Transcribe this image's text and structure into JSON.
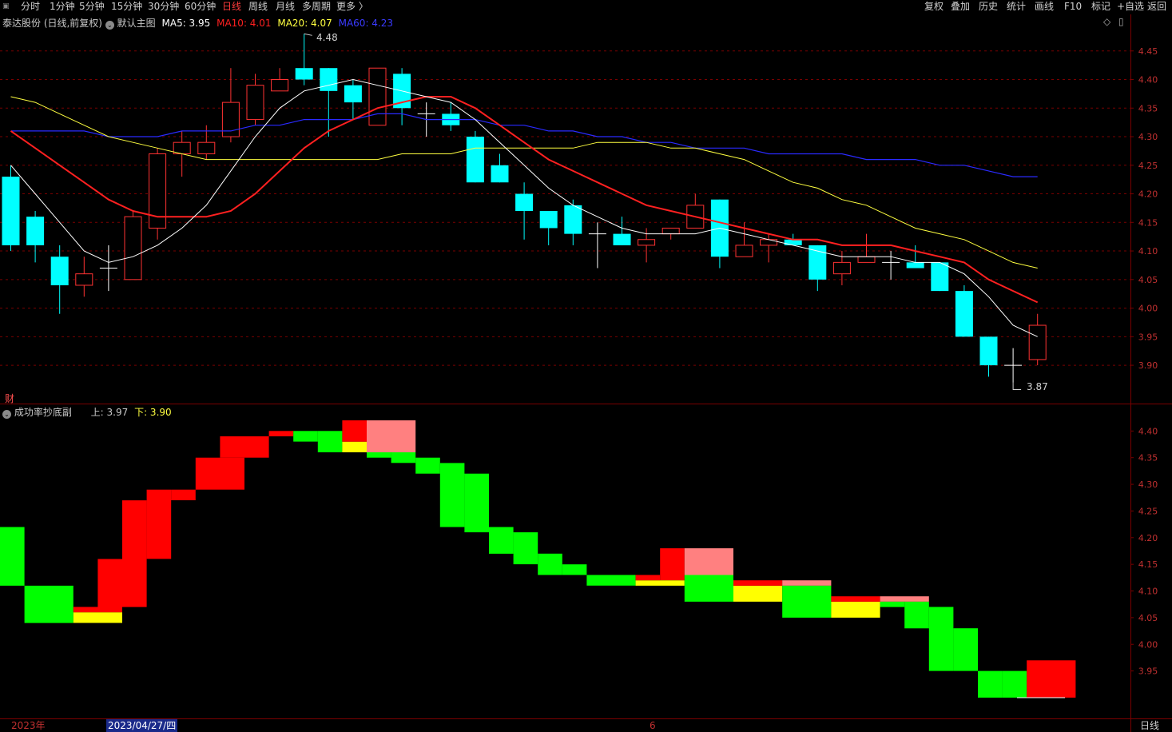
{
  "toolbar": {
    "left_items": [
      "分时",
      "1分钟",
      "5分钟",
      "15分钟",
      "30分钟",
      "60分钟",
      "日线",
      "周线",
      "月线",
      "多周期",
      "更多 〉"
    ],
    "active": "日线",
    "right_items": [
      "复权",
      "叠加",
      "历史",
      "统计",
      "画线",
      "F10",
      "标记",
      "+自选",
      "返回"
    ]
  },
  "main_legend": {
    "stock": "泰达股份 (日线,前复权)",
    "template": "默认主图",
    "ma5": "MA5: 3.95",
    "ma10": "MA10: 4.01",
    "ma20": "MA20: 4.07",
    "ma60": "MA60: 4.23"
  },
  "annotations": {
    "high": "4.48",
    "low": "3.87",
    "cai": "财"
  },
  "sub_legend": {
    "name": "成功率抄底副",
    "up": "上: 3.97",
    "down": "下: 3.90"
  },
  "bottom": {
    "year": "2023年",
    "date": "2023/04/27/四",
    "month": "6",
    "period": "日线"
  },
  "colors": {
    "bg": "#000000",
    "up": "#ff3232",
    "down": "#00ffff",
    "ma5": "#ffffff",
    "ma10": "#ff2020",
    "ma20": "#ffff40",
    "ma60": "#2a2aff",
    "grid": "#7a0000",
    "green": "#00ff00",
    "red": "#ff0000",
    "yellow": "#ffff00",
    "pink": "#ff8080"
  },
  "chart_data": [
    {
      "type": "candlestick",
      "title": "泰达股份 (日线,前复权)",
      "y_ticks": [
        "4.45",
        "4.40",
        "4.35",
        "4.30",
        "4.25",
        "4.20",
        "4.15",
        "4.10",
        "4.05",
        "4.00",
        "3.95",
        "3.90"
      ],
      "ylim": [
        3.84,
        4.5
      ],
      "candles": [
        {
          "o": 4.23,
          "c": 4.11,
          "h": 4.25,
          "l": 4.1
        },
        {
          "o": 4.16,
          "c": 4.11,
          "h": 4.17,
          "l": 4.08
        },
        {
          "o": 4.09,
          "c": 4.04,
          "h": 4.11,
          "l": 3.99
        },
        {
          "o": 4.04,
          "c": 4.06,
          "h": 4.09,
          "l": 4.02
        },
        {
          "o": 4.07,
          "c": 4.07,
          "h": 4.11,
          "l": 4.03
        },
        {
          "o": 4.05,
          "c": 4.16,
          "h": 4.17,
          "l": 4.05
        },
        {
          "o": 4.14,
          "c": 4.27,
          "h": 4.28,
          "l": 4.12
        },
        {
          "o": 4.27,
          "c": 4.29,
          "h": 4.31,
          "l": 4.23
        },
        {
          "o": 4.27,
          "c": 4.29,
          "h": 4.32,
          "l": 4.26
        },
        {
          "o": 4.3,
          "c": 4.36,
          "h": 4.42,
          "l": 4.29
        },
        {
          "o": 4.33,
          "c": 4.39,
          "h": 4.41,
          "l": 4.32
        },
        {
          "o": 4.38,
          "c": 4.4,
          "h": 4.42,
          "l": 4.38
        },
        {
          "o": 4.42,
          "c": 4.4,
          "h": 4.48,
          "l": 4.39
        },
        {
          "o": 4.42,
          "c": 4.38,
          "h": 4.42,
          "l": 4.3
        },
        {
          "o": 4.39,
          "c": 4.36,
          "h": 4.4,
          "l": 4.33
        },
        {
          "o": 4.32,
          "c": 4.42,
          "h": 4.42,
          "l": 4.32
        },
        {
          "o": 4.41,
          "c": 4.35,
          "h": 4.42,
          "l": 4.32
        },
        {
          "o": 4.34,
          "c": 4.34,
          "h": 4.36,
          "l": 4.3
        },
        {
          "o": 4.34,
          "c": 4.32,
          "h": 4.36,
          "l": 4.31
        },
        {
          "o": 4.3,
          "c": 4.22,
          "h": 4.31,
          "l": 4.22
        },
        {
          "o": 4.25,
          "c": 4.22,
          "h": 4.27,
          "l": 4.22
        },
        {
          "o": 4.2,
          "c": 4.17,
          "h": 4.22,
          "l": 4.12
        },
        {
          "o": 4.17,
          "c": 4.14,
          "h": 4.17,
          "l": 4.11
        },
        {
          "o": 4.18,
          "c": 4.13,
          "h": 4.19,
          "l": 4.11
        },
        {
          "o": 4.13,
          "c": 4.13,
          "h": 4.15,
          "l": 4.07
        },
        {
          "o": 4.13,
          "c": 4.11,
          "h": 4.16,
          "l": 4.11
        },
        {
          "o": 4.11,
          "c": 4.12,
          "h": 4.14,
          "l": 4.08
        },
        {
          "o": 4.13,
          "c": 4.14,
          "h": 4.14,
          "l": 4.12
        },
        {
          "o": 4.14,
          "c": 4.18,
          "h": 4.2,
          "l": 4.14
        },
        {
          "o": 4.19,
          "c": 4.09,
          "h": 4.19,
          "l": 4.07
        },
        {
          "o": 4.09,
          "c": 4.11,
          "h": 4.15,
          "l": 4.09
        },
        {
          "o": 4.11,
          "c": 4.12,
          "h": 4.13,
          "l": 4.08
        },
        {
          "o": 4.12,
          "c": 4.11,
          "h": 4.13,
          "l": 4.11
        },
        {
          "o": 4.11,
          "c": 4.05,
          "h": 4.11,
          "l": 4.03
        },
        {
          "o": 4.06,
          "c": 4.08,
          "h": 4.1,
          "l": 4.04
        },
        {
          "o": 4.08,
          "c": 4.09,
          "h": 4.13,
          "l": 4.08
        },
        {
          "o": 4.08,
          "c": 4.08,
          "h": 4.1,
          "l": 4.05
        },
        {
          "o": 4.08,
          "c": 4.07,
          "h": 4.11,
          "l": 4.07
        },
        {
          "o": 4.08,
          "c": 4.03,
          "h": 4.08,
          "l": 4.03
        },
        {
          "o": 4.03,
          "c": 3.95,
          "h": 4.04,
          "l": 3.95
        },
        {
          "o": 3.95,
          "c": 3.9,
          "h": 3.95,
          "l": 3.88
        },
        {
          "o": 3.9,
          "c": 3.9,
          "h": 3.93,
          "l": 3.87
        },
        {
          "o": 3.91,
          "c": 3.97,
          "h": 3.99,
          "l": 3.9
        }
      ],
      "ma5": [
        4.25,
        4.2,
        4.15,
        4.1,
        4.08,
        4.09,
        4.11,
        4.14,
        4.18,
        4.24,
        4.3,
        4.35,
        4.38,
        4.39,
        4.4,
        4.39,
        4.38,
        4.37,
        4.36,
        4.33,
        4.29,
        4.25,
        4.21,
        4.18,
        4.16,
        4.14,
        4.13,
        4.13,
        4.13,
        4.14,
        4.13,
        4.12,
        4.11,
        4.1,
        4.09,
        4.09,
        4.09,
        4.08,
        4.08,
        4.06,
        4.02,
        3.97,
        3.95
      ],
      "ma10": [
        4.31,
        4.28,
        4.25,
        4.22,
        4.19,
        4.17,
        4.16,
        4.16,
        4.16,
        4.17,
        4.2,
        4.24,
        4.28,
        4.31,
        4.33,
        4.35,
        4.36,
        4.37,
        4.37,
        4.35,
        4.32,
        4.29,
        4.26,
        4.24,
        4.22,
        4.2,
        4.18,
        4.17,
        4.16,
        4.15,
        4.14,
        4.13,
        4.12,
        4.12,
        4.11,
        4.11,
        4.11,
        4.1,
        4.09,
        4.08,
        4.05,
        4.03,
        4.01
      ],
      "ma20": [
        4.37,
        4.36,
        4.34,
        4.32,
        4.3,
        4.29,
        4.28,
        4.27,
        4.26,
        4.26,
        4.26,
        4.26,
        4.26,
        4.26,
        4.26,
        4.26,
        4.27,
        4.27,
        4.27,
        4.28,
        4.28,
        4.28,
        4.28,
        4.28,
        4.29,
        4.29,
        4.29,
        4.28,
        4.28,
        4.27,
        4.26,
        4.24,
        4.22,
        4.21,
        4.19,
        4.18,
        4.16,
        4.14,
        4.13,
        4.12,
        4.1,
        4.08,
        4.07
      ],
      "ma60": [
        4.31,
        4.31,
        4.31,
        4.31,
        4.3,
        4.3,
        4.3,
        4.31,
        4.31,
        4.31,
        4.32,
        4.32,
        4.33,
        4.33,
        4.33,
        4.34,
        4.34,
        4.33,
        4.33,
        4.33,
        4.32,
        4.32,
        4.31,
        4.31,
        4.3,
        4.3,
        4.29,
        4.29,
        4.28,
        4.28,
        4.28,
        4.27,
        4.27,
        4.27,
        4.27,
        4.26,
        4.26,
        4.26,
        4.25,
        4.25,
        4.24,
        4.23,
        4.23
      ]
    },
    {
      "type": "bar",
      "title": "成功率抄底副",
      "y_ticks": [
        "4.40",
        "4.35",
        "4.30",
        "4.25",
        "4.20",
        "4.15",
        "4.10",
        "4.05",
        "4.00",
        "3.95"
      ],
      "ylim": [
        3.87,
        4.42
      ],
      "blocks": [
        {
          "x0": 0,
          "x1": 1,
          "lo": 4.11,
          "hi": 4.22,
          "color": "green"
        },
        {
          "x0": 1,
          "x1": 3,
          "lo": 4.04,
          "hi": 4.11,
          "color": "green"
        },
        {
          "x0": 3,
          "x1": 5,
          "lo": 4.04,
          "hi": 4.06,
          "color": "yellow"
        },
        {
          "x0": 3,
          "x1": 5,
          "lo": 4.06,
          "hi": 4.07,
          "color": "red"
        },
        {
          "x0": 4,
          "x1": 5,
          "lo": 4.07,
          "hi": 4.16,
          "color": "red"
        },
        {
          "x0": 5,
          "x1": 6,
          "lo": 4.07,
          "hi": 4.27,
          "color": "red"
        },
        {
          "x0": 6,
          "x1": 7,
          "lo": 4.16,
          "hi": 4.29,
          "color": "red"
        },
        {
          "x0": 7,
          "x1": 8,
          "lo": 4.27,
          "hi": 4.29,
          "color": "red"
        },
        {
          "x0": 8,
          "x1": 10,
          "lo": 4.29,
          "hi": 4.35,
          "color": "red"
        },
        {
          "x0": 9,
          "x1": 11,
          "lo": 4.35,
          "hi": 4.39,
          "color": "red"
        },
        {
          "x0": 11,
          "x1": 12,
          "lo": 4.39,
          "hi": 4.4,
          "color": "red"
        },
        {
          "x0": 12,
          "x1": 13,
          "lo": 4.38,
          "hi": 4.4,
          "color": "green"
        },
        {
          "x0": 13,
          "x1": 14,
          "lo": 4.36,
          "hi": 4.4,
          "color": "green"
        },
        {
          "x0": 14,
          "x1": 15,
          "lo": 4.36,
          "hi": 4.38,
          "color": "yellow"
        },
        {
          "x0": 14,
          "x1": 15,
          "lo": 4.38,
          "hi": 4.42,
          "color": "red"
        },
        {
          "x0": 15,
          "x1": 17,
          "lo": 4.36,
          "hi": 4.42,
          "color": "pink"
        },
        {
          "x0": 15,
          "x1": 16,
          "lo": 4.35,
          "hi": 4.36,
          "color": "green"
        },
        {
          "x0": 16,
          "x1": 17,
          "lo": 4.34,
          "hi": 4.36,
          "color": "green"
        },
        {
          "x0": 17,
          "x1": 18,
          "lo": 4.32,
          "hi": 4.35,
          "color": "green"
        },
        {
          "x0": 18,
          "x1": 19,
          "lo": 4.22,
          "hi": 4.34,
          "color": "green"
        },
        {
          "x0": 19,
          "x1": 20,
          "lo": 4.21,
          "hi": 4.32,
          "color": "green"
        },
        {
          "x0": 20,
          "x1": 21,
          "lo": 4.17,
          "hi": 4.22,
          "color": "green"
        },
        {
          "x0": 21,
          "x1": 22,
          "lo": 4.15,
          "hi": 4.21,
          "color": "green"
        },
        {
          "x0": 22,
          "x1": 23,
          "lo": 4.13,
          "hi": 4.17,
          "color": "green"
        },
        {
          "x0": 23,
          "x1": 24,
          "lo": 4.13,
          "hi": 4.15,
          "color": "green"
        },
        {
          "x0": 24,
          "x1": 26,
          "lo": 4.11,
          "hi": 4.13,
          "color": "green"
        },
        {
          "x0": 26,
          "x1": 28,
          "lo": 4.11,
          "hi": 4.12,
          "color": "yellow"
        },
        {
          "x0": 26,
          "x1": 27,
          "lo": 4.12,
          "hi": 4.13,
          "color": "red"
        },
        {
          "x0": 27,
          "x1": 28,
          "lo": 4.12,
          "hi": 4.18,
          "color": "red"
        },
        {
          "x0": 28,
          "x1": 30,
          "lo": 4.13,
          "hi": 4.18,
          "color": "pink"
        },
        {
          "x0": 28,
          "x1": 30,
          "lo": 4.08,
          "hi": 4.13,
          "color": "green"
        },
        {
          "x0": 30,
          "x1": 32,
          "lo": 4.08,
          "hi": 4.11,
          "color": "yellow"
        },
        {
          "x0": 30,
          "x1": 32,
          "lo": 4.11,
          "hi": 4.12,
          "color": "red"
        },
        {
          "x0": 32,
          "x1": 34,
          "lo": 4.11,
          "hi": 4.12,
          "color": "pink"
        },
        {
          "x0": 32,
          "x1": 34,
          "lo": 4.05,
          "hi": 4.11,
          "color": "green"
        },
        {
          "x0": 34,
          "x1": 36,
          "lo": 4.05,
          "hi": 4.08,
          "color": "yellow"
        },
        {
          "x0": 34,
          "x1": 36,
          "lo": 4.08,
          "hi": 4.09,
          "color": "red"
        },
        {
          "x0": 36,
          "x1": 38,
          "lo": 4.08,
          "hi": 4.09,
          "color": "pink"
        },
        {
          "x0": 36,
          "x1": 37,
          "lo": 4.07,
          "hi": 4.08,
          "color": "green"
        },
        {
          "x0": 37,
          "x1": 38,
          "lo": 4.03,
          "hi": 4.08,
          "color": "green"
        },
        {
          "x0": 38,
          "x1": 39,
          "lo": 3.95,
          "hi": 4.07,
          "color": "green"
        },
        {
          "x0": 39,
          "x1": 40,
          "lo": 3.95,
          "hi": 4.03,
          "color": "green"
        },
        {
          "x0": 40,
          "x1": 41,
          "lo": 3.9,
          "hi": 3.95,
          "color": "green"
        },
        {
          "x0": 41,
          "x1": 42,
          "lo": 3.9,
          "hi": 3.95,
          "color": "green"
        },
        {
          "x0": 42,
          "x1": 44,
          "lo": 3.9,
          "hi": 3.97,
          "color": "red"
        }
      ]
    }
  ]
}
